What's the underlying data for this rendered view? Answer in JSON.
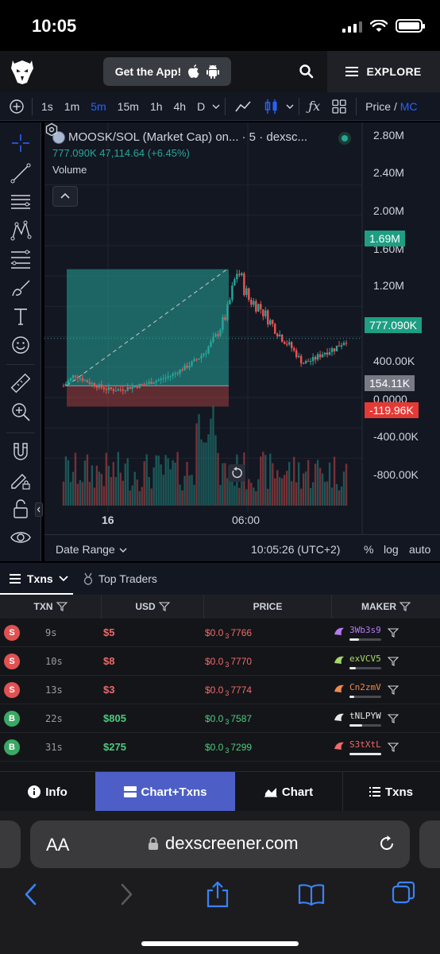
{
  "status_bar": {
    "time": "10:05"
  },
  "header": {
    "get_app_label": "Get the App!",
    "explore_label": "EXPLORE"
  },
  "toolbar": {
    "intervals": [
      "1s",
      "1m",
      "5m",
      "15m",
      "1h",
      "4h",
      "D"
    ],
    "active_interval": "5m",
    "price_label": "Price /",
    "price_label_suffix": "MC"
  },
  "chart": {
    "pair_title": "MOOSK/SOL (Market Cap) on...",
    "interval_source": "· 5 · dexsc...",
    "last_value": "777.090K",
    "change": "47,114.64 (+6.45%)",
    "volume_label": "Volume",
    "y_axis_labels": [
      "2.80M",
      "2.40M",
      "2.00M",
      "1.60M",
      "1.20M",
      "400.00K",
      "0.0000",
      "-400.00K",
      "-800.00K"
    ],
    "badges": {
      "high": "1.69M",
      "current": "777.090K",
      "mid": "154.11K",
      "low": "-119.96K"
    },
    "x_axis_labels": [
      "16",
      "06:00"
    ],
    "date_range_label": "Date Range",
    "clock": "10:05:26 (UTC+2)",
    "pct_label": "%",
    "log_label": "log",
    "auto_label": "auto",
    "colors": {
      "up": "#26a69a",
      "down": "#ef5350",
      "background": "#131722"
    }
  },
  "chart_data": {
    "type": "candlestick",
    "title": "MOOSK/SOL (Market Cap)",
    "ylabel": "Market Cap",
    "ylim": [
      -1000000,
      3000000
    ],
    "x_ticks": [
      "16",
      "06:00"
    ],
    "close_series_approx": [
      150000,
      300000,
      220000,
      160000,
      110000,
      100000,
      130000,
      160000,
      200000,
      240000,
      300000,
      380000,
      470000,
      600000,
      800000,
      1100000,
      1690000,
      1300000,
      1200000,
      1000000,
      800000,
      650000,
      450000,
      500000,
      600000,
      650000,
      777090
    ],
    "annotations": {
      "measure_box_top": 1690000,
      "measure_box_baseline": 154110,
      "measure_box_bottom": -119960,
      "last_price": 777090
    }
  },
  "txns": {
    "tab_txns": "Txns",
    "tab_top_traders": "Top Traders",
    "columns": [
      "TXN",
      "USD",
      "PRICE",
      "MAKER"
    ],
    "rows": [
      {
        "type": "S",
        "age": "9s",
        "usd": "$5",
        "price_prefix": "$0.0",
        "price_sub": "3",
        "price_rest": "7766",
        "maker": "3Wb3s9",
        "maker_color": "#b67af0",
        "maker_bar": 0.3
      },
      {
        "type": "S",
        "age": "10s",
        "usd": "$8",
        "price_prefix": "$0.0",
        "price_sub": "3",
        "price_rest": "7770",
        "maker": "exVCV5",
        "maker_color": "#a8d86a",
        "maker_bar": 0.2
      },
      {
        "type": "S",
        "age": "13s",
        "usd": "$3",
        "price_prefix": "$0.0",
        "price_sub": "3",
        "price_rest": "7774",
        "maker": "Cn2zmV",
        "maker_color": "#f08a4a",
        "maker_bar": 0.15
      },
      {
        "type": "B",
        "age": "22s",
        "usd": "$805",
        "price_prefix": "$0.0",
        "price_sub": "3",
        "price_rest": "7587",
        "maker": "tNLPYW",
        "maker_color": "#e8e8e8",
        "maker_bar": 0.4
      },
      {
        "type": "B",
        "age": "31s",
        "usd": "$275",
        "price_prefix": "$0.0",
        "price_sub": "3",
        "price_rest": "7299",
        "maker": "S3tXtL",
        "maker_color": "#f06a6a",
        "maker_bar": 1.0
      }
    ]
  },
  "bottom_tabs": [
    {
      "label": "Info",
      "icon": "info-icon"
    },
    {
      "label": "Chart+Txns",
      "icon": "chart-txns-icon",
      "active": true
    },
    {
      "label": "Chart",
      "icon": "chart-icon"
    },
    {
      "label": "Txns",
      "icon": "list-icon"
    }
  ],
  "browser": {
    "aa_label": "AA",
    "url": "dexscreener.com"
  }
}
